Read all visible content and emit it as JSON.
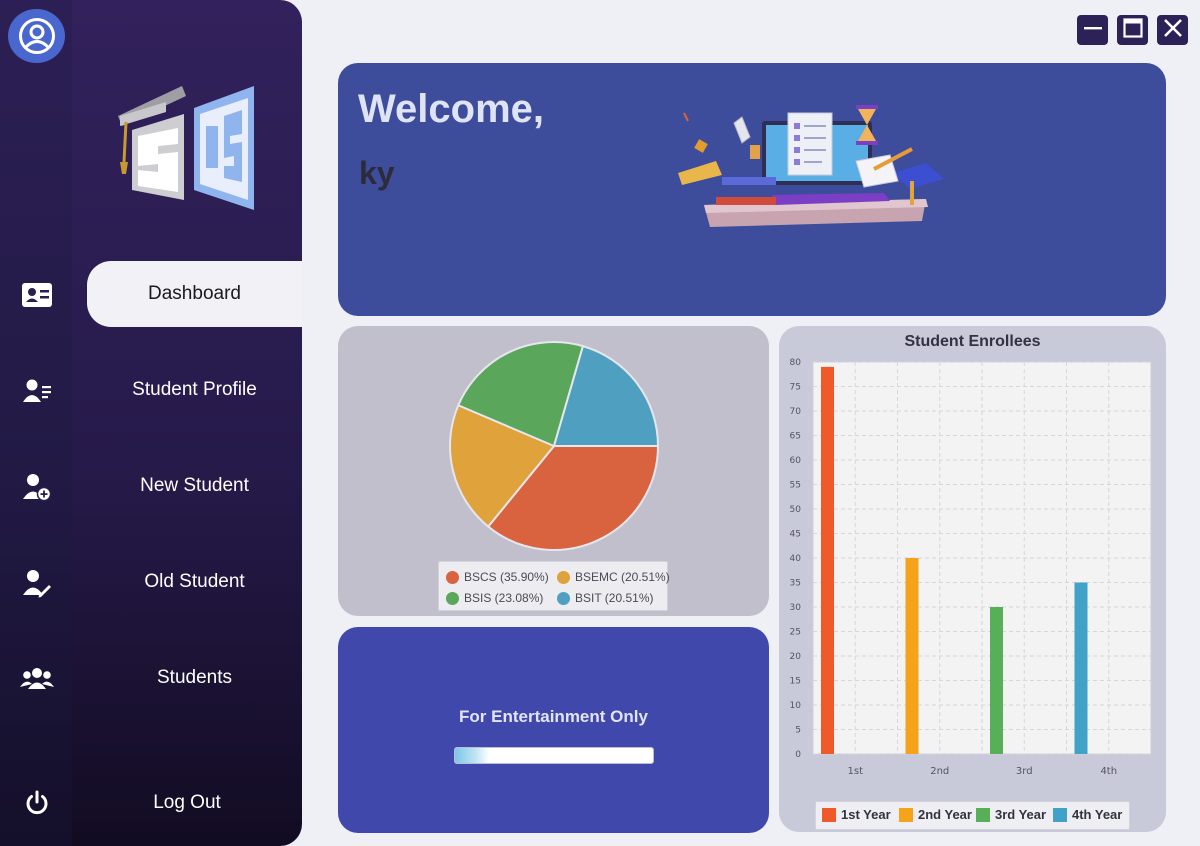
{
  "window_controls": {
    "minimize": "minimize-icon",
    "maximize": "maximize-icon",
    "close": "close-icon"
  },
  "rail": {
    "avatar_icon": "user-avatar-icon",
    "items": [
      {
        "icon": "dashboard-id-card-icon"
      },
      {
        "icon": "student-profile-icon"
      },
      {
        "icon": "add-user-icon"
      },
      {
        "icon": "edit-user-icon"
      },
      {
        "icon": "group-users-icon"
      },
      {
        "icon": "power-icon"
      }
    ]
  },
  "nav": {
    "logo": "sis-logo",
    "items": [
      {
        "label": "Dashboard",
        "active": true
      },
      {
        "label": "Student Profile"
      },
      {
        "label": "New Student"
      },
      {
        "label": "Old Student"
      },
      {
        "label": "Students"
      },
      {
        "label": "Log Out"
      }
    ]
  },
  "welcome": {
    "title": "Welcome,",
    "username": "ky",
    "illustration": "computer-education-illustration"
  },
  "pie_legend": [
    {
      "label": "BSCS (35.90%)",
      "color": "#d9633e"
    },
    {
      "label": "BSEMC (20.51%)",
      "color": "#e0a23a"
    },
    {
      "label": "BSIS (23.08%)",
      "color": "#5aa65a"
    },
    {
      "label": "BSIT (20.51%)",
      "color": "#4fa0c0"
    }
  ],
  "entertainment": {
    "title": "For Entertainment Only",
    "progress": 0.17
  },
  "chart_data": [
    {
      "type": "pie",
      "labels": [
        "BSCS",
        "BSEMC",
        "BSIS",
        "BSIT"
      ],
      "values": [
        35.9,
        20.51,
        23.08,
        20.51
      ],
      "legend": "bottom"
    },
    {
      "type": "bar",
      "title": "Student Enrollees",
      "categories": [
        "1st",
        "2nd",
        "3rd",
        "4th"
      ],
      "series": [
        {
          "name": "1st Year",
          "values": [
            79,
            0,
            0,
            0
          ],
          "color": "#f05a28"
        },
        {
          "name": "2nd Year",
          "values": [
            0,
            40,
            0,
            0
          ],
          "color": "#f5a31a"
        },
        {
          "name": "3rd Year",
          "values": [
            0,
            0,
            30,
            0
          ],
          "color": "#57b057"
        },
        {
          "name": "4th Year",
          "values": [
            0,
            0,
            0,
            35
          ],
          "color": "#41a2c8"
        }
      ],
      "ylim": [
        0,
        80
      ],
      "ytick_step": 5,
      "grid": true,
      "legend": "bottom"
    }
  ]
}
